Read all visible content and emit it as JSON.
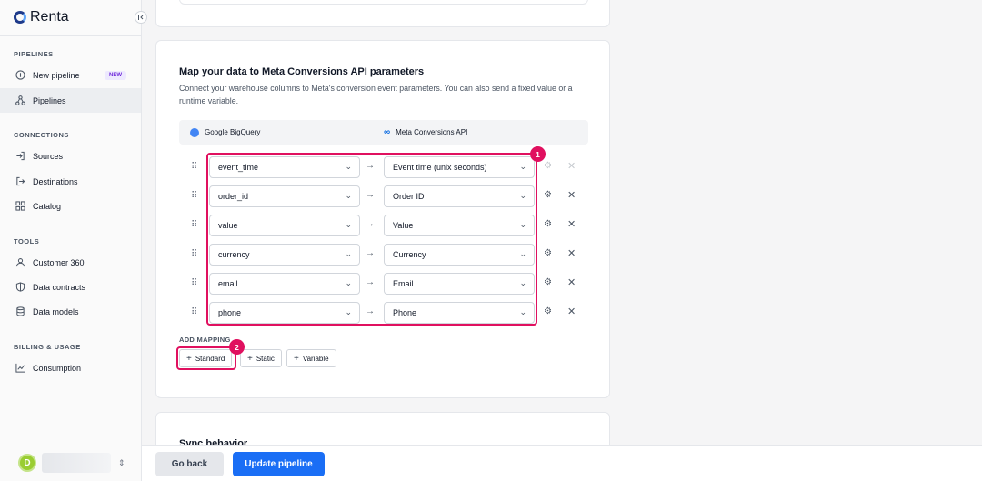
{
  "app": {
    "name": "Renta"
  },
  "sidebar": {
    "collapse_icon": "chevron-left-bar",
    "sections": [
      {
        "title": "PIPELINES",
        "items": [
          {
            "label": "New pipeline",
            "icon": "plus-circle",
            "badge": "NEW"
          },
          {
            "label": "Pipelines",
            "icon": "flow",
            "active": true
          }
        ]
      },
      {
        "title": "CONNECTIONS",
        "items": [
          {
            "label": "Sources",
            "icon": "login"
          },
          {
            "label": "Destinations",
            "icon": "logout"
          },
          {
            "label": "Catalog",
            "icon": "grid"
          }
        ]
      },
      {
        "title": "TOOLS",
        "items": [
          {
            "label": "Customer 360",
            "icon": "user"
          },
          {
            "label": "Data contracts",
            "icon": "shield"
          },
          {
            "label": "Data models",
            "icon": "database"
          }
        ]
      },
      {
        "title": "BILLING & USAGE",
        "items": [
          {
            "label": "Consumption",
            "icon": "chart-line"
          }
        ]
      }
    ],
    "user": {
      "avatar_letter": "D"
    }
  },
  "mapping": {
    "title": "Map your data to Meta Conversions API parameters",
    "description": "Connect your warehouse columns to Meta's conversion event parameters. You can also send a fixed value or a runtime variable.",
    "source_label": "Google BigQuery",
    "destination_label": "Meta Conversions API",
    "rows": [
      {
        "source": "event_time",
        "destination": "Event time (unix seconds)",
        "removable": false
      },
      {
        "source": "order_id",
        "destination": "Order ID",
        "removable": true
      },
      {
        "source": "value",
        "destination": "Value",
        "removable": true
      },
      {
        "source": "currency",
        "destination": "Currency",
        "removable": true
      },
      {
        "source": "email",
        "destination": "Email",
        "removable": true
      },
      {
        "source": "phone",
        "destination": "Phone",
        "removable": true
      }
    ],
    "add_mapping_label": "ADD MAPPING",
    "add_buttons": {
      "standard": "Standard",
      "static": "Static",
      "variable": "Variable"
    },
    "markers": [
      "1",
      "2"
    ],
    "highlight_color": "#e0105f"
  },
  "sync": {
    "title": "Sync behavior"
  },
  "footer": {
    "back_label": "Go back",
    "update_label": "Update pipeline",
    "primary_color": "#1a6ef5"
  }
}
